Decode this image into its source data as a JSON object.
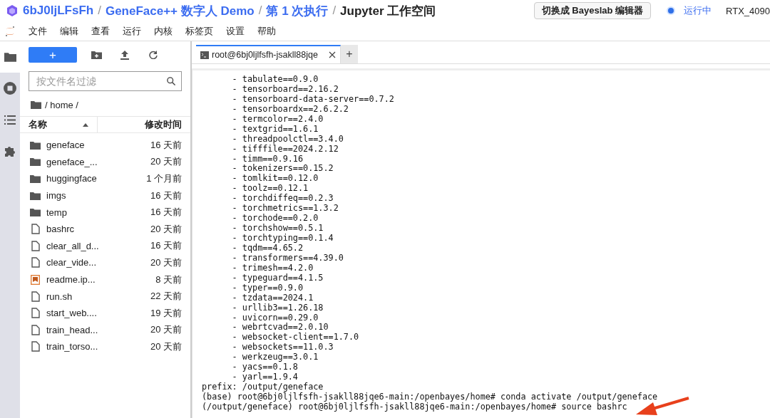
{
  "header": {
    "breadcrumbs": [
      "6bJ0ljLFsFh",
      "GeneFace++ 数字人 Demo",
      "第 1 次执行",
      "Jupyter 工作空间"
    ],
    "separator": "/",
    "switch_button": "切换成 Bayeslab 编辑器",
    "status": "运行中",
    "gpu": "RTX_4090"
  },
  "menu": [
    "文件",
    "编辑",
    "查看",
    "运行",
    "内核",
    "标签页",
    "设置",
    "帮助"
  ],
  "rail": [
    {
      "kind": "folder",
      "selected": true
    },
    {
      "kind": "stop",
      "selected": false
    },
    {
      "kind": "list",
      "selected": false
    },
    {
      "kind": "puzzle",
      "selected": false
    }
  ],
  "files": {
    "new_button": "+",
    "filter": {
      "placeholder": "按文件名过滤"
    },
    "path": "/ home /",
    "columns": [
      "名称",
      "修改时间"
    ],
    "rows": [
      {
        "kind": "folder",
        "name": "geneface",
        "modified": "16 天前"
      },
      {
        "kind": "folder",
        "name": "geneface_...",
        "modified": "20 天前"
      },
      {
        "kind": "folder",
        "name": "huggingface",
        "modified": "1 个月前"
      },
      {
        "kind": "folder",
        "name": "imgs",
        "modified": "16 天前"
      },
      {
        "kind": "folder",
        "name": "temp",
        "modified": "16 天前"
      },
      {
        "kind": "file",
        "name": "bashrc",
        "modified": "20 天前"
      },
      {
        "kind": "file",
        "name": "clear_all_d...",
        "modified": "16 天前"
      },
      {
        "kind": "file",
        "name": "clear_vide...",
        "modified": "20 天前"
      },
      {
        "kind": "notebook",
        "name": "readme.ip...",
        "modified": "8 天前"
      },
      {
        "kind": "file",
        "name": "run.sh",
        "modified": "22 天前"
      },
      {
        "kind": "file",
        "name": "start_web....",
        "modified": "19 天前"
      },
      {
        "kind": "file",
        "name": "train_head...",
        "modified": "20 天前"
      },
      {
        "kind": "file",
        "name": "train_torso...",
        "modified": "20 天前"
      }
    ]
  },
  "terminal": {
    "tabs": [
      {
        "label": "root@6bj0ljlfsfh-jsakll88jqe",
        "selected": true
      }
    ],
    "new_tab": "+",
    "lines": [
      "      - tabulate==0.9.0",
      "      - tensorboard==2.16.2",
      "      - tensorboard-data-server==0.7.2",
      "      - tensorboardx==2.6.2.2",
      "      - termcolor==2.4.0",
      "      - textgrid==1.6.1",
      "      - threadpoolctl==3.4.0",
      "      - tifffile==2024.2.12",
      "      - timm==0.9.16",
      "      - tokenizers==0.15.2",
      "      - tomlkit==0.12.0",
      "      - toolz==0.12.1",
      "      - torchdiffeq==0.2.3",
      "      - torchmetrics==1.3.2",
      "      - torchode==0.2.0",
      "      - torchshow==0.5.1",
      "      - torchtyping==0.1.4",
      "      - tqdm==4.65.2",
      "      - transformers==4.39.0",
      "      - trimesh==4.2.0",
      "      - typeguard==4.1.5",
      "      - typer==0.9.0",
      "      - tzdata==2024.1",
      "      - urllib3==1.26.18",
      "      - uvicorn==0.29.0",
      "      - webrtcvad==2.0.10",
      "      - websocket-client==1.7.0",
      "      - websockets==11.0.3",
      "      - werkzeug==3.0.1",
      "      - yacs==0.1.8",
      "      - yarl==1.9.4",
      "prefix: /output/geneface",
      "(base) root@6bj0ljlfsfh-jsakll88jqe6-main:/openbayes/home# conda activate /output/geneface",
      "(/output/geneface) root@6bj0ljlfsfh-jsakll88jqe6-main:/openbayes/home# source bashrc"
    ]
  }
}
